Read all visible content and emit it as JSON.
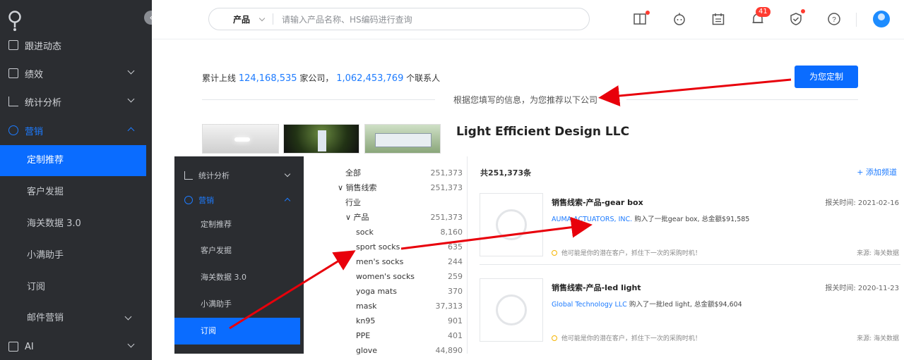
{
  "sidebar": {
    "items": [
      {
        "label": "跟进动态",
        "icon": "list-icon"
      },
      {
        "label": "绩效",
        "icon": "document-icon"
      },
      {
        "label": "统计分析",
        "icon": "chart-icon"
      },
      {
        "label": "营销",
        "icon": "target-icon"
      }
    ],
    "subitems": [
      "定制推荐",
      "客户发掘",
      "海关数据 3.0",
      "小满助手",
      "订阅",
      "邮件营销"
    ],
    "bottom_item": {
      "label": "AI",
      "icon": "ai-icon"
    }
  },
  "topbar": {
    "search": {
      "select_label": "产品",
      "placeholder": "请输入产品名称、HS编码进行查询"
    },
    "notification_count": "41"
  },
  "main": {
    "summary": {
      "prefix": "累计上线",
      "companies": "124,168,535",
      "companies_suffix": "家公司，",
      "contacts": "1,062,453,769",
      "contacts_suffix": "个联系人"
    },
    "customize_button": "为您定制",
    "recommend_title": "根据您填写的信息，为您推荐以下公司",
    "company_name": "Light Efficient Design LLC"
  },
  "overlay": {
    "sidebar": {
      "items": [
        "统计分析",
        "营销"
      ],
      "subitems": [
        "定制推荐",
        "客户发掘",
        "海关数据 3.0",
        "小满助手",
        "订阅"
      ]
    },
    "tree": [
      {
        "label": "全部",
        "count": "251,373"
      },
      {
        "label": "∨ 销售线索",
        "count": "251,373"
      },
      {
        "label": "行业",
        "count": ""
      },
      {
        "label": "∨ 产品",
        "count": "251,373"
      },
      {
        "label": "sock",
        "count": "8,160"
      },
      {
        "label": "sport socks",
        "count": "635"
      },
      {
        "label": "men's socks",
        "count": "244"
      },
      {
        "label": "women's socks",
        "count": "259"
      },
      {
        "label": "yoga mats",
        "count": "370"
      },
      {
        "label": "mask",
        "count": "37,313"
      },
      {
        "label": "kn95",
        "count": "901"
      },
      {
        "label": "PPE",
        "count": "401"
      },
      {
        "label": "glove",
        "count": "44,890"
      }
    ],
    "feed": {
      "total": "共251,373条",
      "add_channel": "+ 添加频道",
      "cards": [
        {
          "title": "销售线索-产品-gear box",
          "time": "报关时间: 2021-02-16",
          "company": "AUMA ACTUATORS, INC.",
          "desc": "购入了一批gear box, 总金额$91,585",
          "tip": "他可能是你的潜在客户，抓住下一次的采购时机！",
          "source": "来源: 海关数据"
        },
        {
          "title": "销售线索-产品-led light",
          "time": "报关时间: 2020-11-23",
          "company": "Global Technology LLC",
          "desc": "购入了一批led light, 总金额$94,604",
          "tip": "他可能是你的潜在客户，抓住下一次的采购时机！",
          "source": "来源: 海关数据"
        }
      ]
    }
  },
  "colors": {
    "accent": "#0a6cff",
    "sidebar_bg": "#2b2d31",
    "arrow": "#e8000b"
  }
}
